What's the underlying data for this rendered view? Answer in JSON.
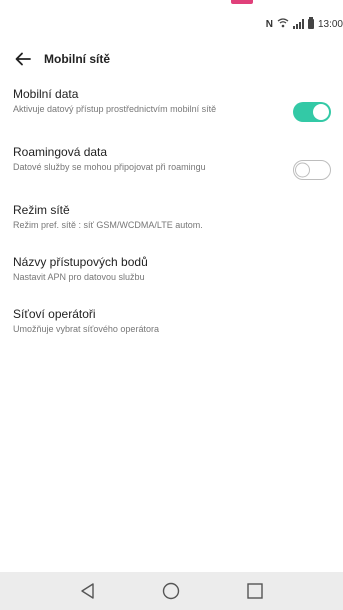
{
  "status_bar": {
    "nfc": "N",
    "time": "13:00"
  },
  "header": {
    "title": "Mobilní sítě"
  },
  "settings": [
    {
      "title": "Mobilní data",
      "subtitle": "Aktivuje datový přístup prostřednictvím mobilní sítě",
      "toggle": "on"
    },
    {
      "title": "Roamingová data",
      "subtitle": "Datové služby se mohou připojovat při roamingu",
      "toggle": "off"
    },
    {
      "title": "Režim sítě",
      "subtitle": "Režim pref. sítě : síť GSM/WCDMA/LTE autom."
    },
    {
      "title": "Názvy přístupových bodů",
      "subtitle": "Nastavit APN pro datovou službu"
    },
    {
      "title": "Síťoví operátoři",
      "subtitle": "Umožňuje vybrat síťového operátora"
    }
  ],
  "colors": {
    "toggle_on": "#33c9a6",
    "top_mark": "#e0407a",
    "nav_bar": "#ececec"
  },
  "icons": {
    "back": "arrow-left-icon",
    "nav_back": "triangle-back-icon",
    "nav_home": "circle-home-icon",
    "nav_recents": "square-recents-icon"
  }
}
